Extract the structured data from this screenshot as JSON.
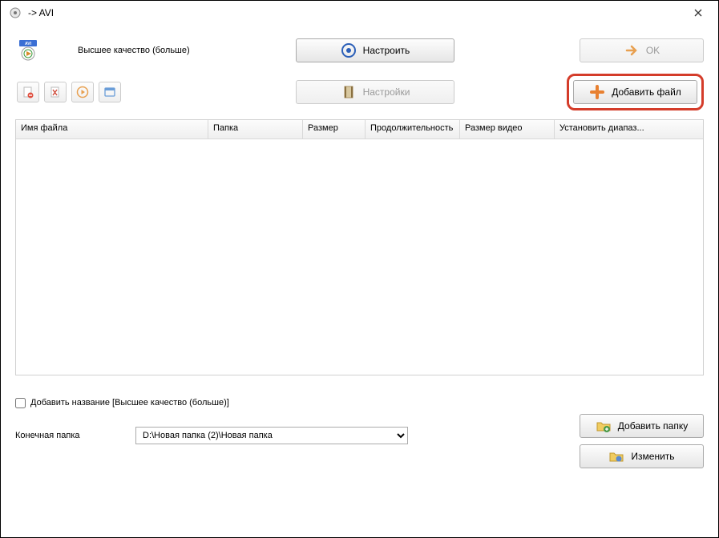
{
  "window": {
    "title": "-> AVI"
  },
  "top": {
    "quality_label": "Высшее качество (больше)",
    "configure_btn": "Настроить",
    "ok_btn": "OK"
  },
  "second": {
    "settings_btn": "Настройки",
    "add_file_btn": "Добавить файл"
  },
  "columns": {
    "c1": "Имя файла",
    "c2": "Папка",
    "c3": "Размер",
    "c4": "Продолжительность",
    "c5": "Размер видео",
    "c6": "Установить диапаз..."
  },
  "bottom": {
    "checkbox_label": "Добавить название [Высшее качество (больше)]",
    "dest_label": "Конечная папка",
    "dest_value": "D:\\Новая папка (2)\\Новая папка",
    "add_folder_btn": "Добавить папку",
    "change_btn": "Изменить"
  }
}
